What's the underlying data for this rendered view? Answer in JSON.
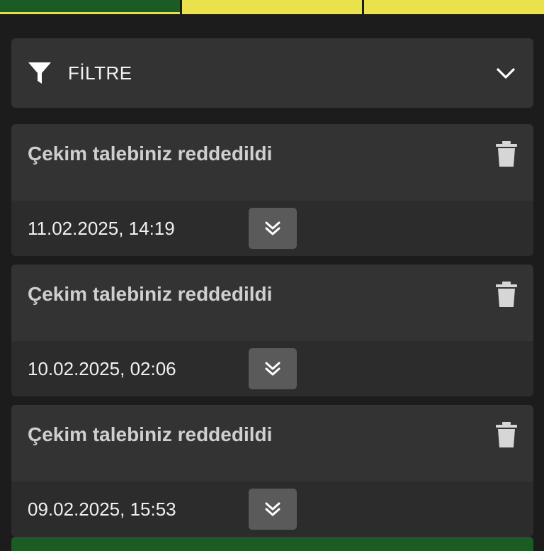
{
  "colors": {
    "page_bg": "#1c1c1c",
    "panel_bg": "#333333",
    "card_footer_bg": "#2c2c2c",
    "active_tab": "#1a5c24",
    "inactive_tab": "#e9e24d",
    "expand_button": "#5a5a5a"
  },
  "tabs": [
    {
      "label": "",
      "state": "active"
    },
    {
      "label": "",
      "state": "inactive"
    },
    {
      "label": "",
      "state": "inactive"
    }
  ],
  "filter": {
    "icon": "funnel-icon",
    "label": "FİLTRE",
    "toggle_icon": "chevron-down-icon"
  },
  "notifications": [
    {
      "title": "Çekim talebiniz reddedildi",
      "date": "11.02.2025, 14:19",
      "delete_icon": "trash-icon",
      "expand_icon": "double-chevron-down-icon"
    },
    {
      "title": "Çekim talebiniz reddedildi",
      "date": "10.02.2025, 02:06",
      "delete_icon": "trash-icon",
      "expand_icon": "double-chevron-down-icon"
    },
    {
      "title": "Çekim talebiniz reddedildi",
      "date": "09.02.2025, 15:53",
      "delete_icon": "trash-icon",
      "expand_icon": "double-chevron-down-icon"
    }
  ]
}
